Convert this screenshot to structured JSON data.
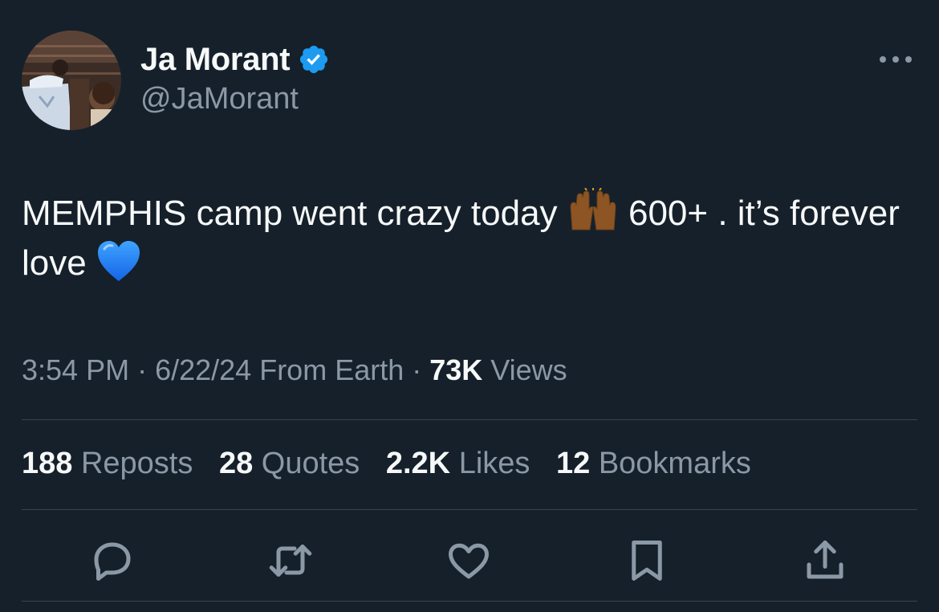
{
  "author": {
    "display_name": "Ja Morant",
    "handle": "@JaMorant",
    "verified": true,
    "verified_color": "#1d9bf0"
  },
  "more_icon": "more-horizontal-icon",
  "tweet": {
    "text_part1": "MEMPHIS camp went crazy today ",
    "emoji_1": "raising-hands-emoji",
    "text_part2": " 600+ . it’s forever love ",
    "emoji_2": "blue-heart-emoji"
  },
  "meta": {
    "time": "3:54 PM",
    "sep1": " · ",
    "date": "6/22/24",
    "source": " From Earth",
    "sep2": " · ",
    "views_count": "73K",
    "views_label": " Views"
  },
  "stats": [
    {
      "count": "188",
      "label": " Reposts"
    },
    {
      "count": "28",
      "label": " Quotes"
    },
    {
      "count": "2.2K",
      "label": " Likes"
    },
    {
      "count": "12",
      "label": " Bookmarks"
    }
  ],
  "actions": [
    "reply-icon",
    "repost-icon",
    "like-icon",
    "bookmark-icon",
    "share-icon"
  ],
  "colors": {
    "background": "#15202b",
    "primary_text": "#f7f9f9",
    "secondary_text": "#8b98a5",
    "divider": "#38444d",
    "accent": "#1d9bf0"
  }
}
